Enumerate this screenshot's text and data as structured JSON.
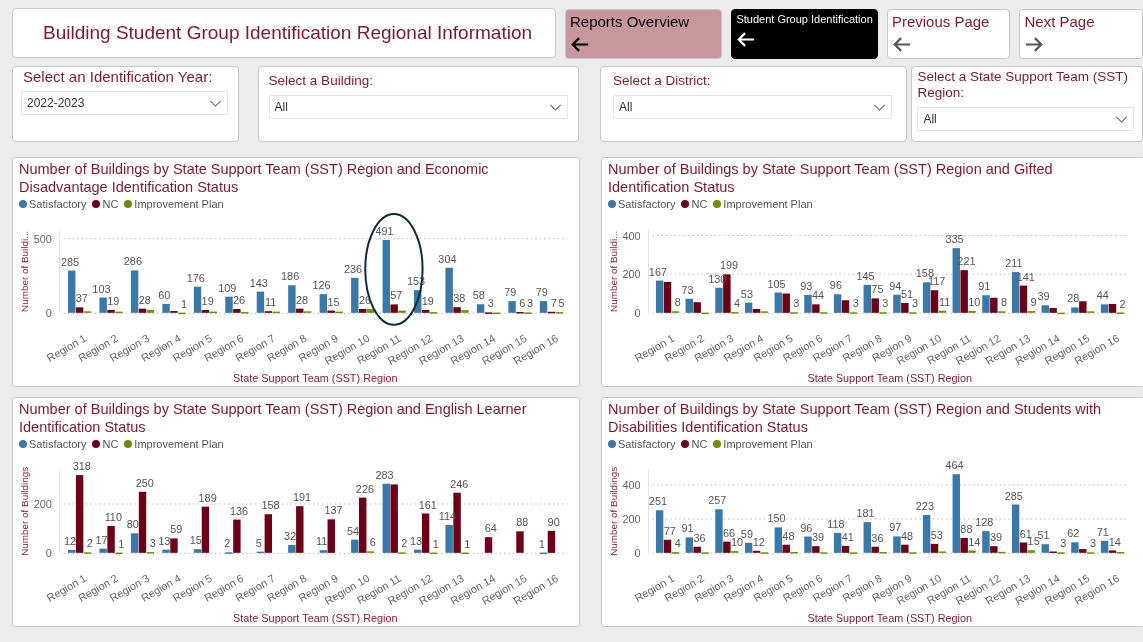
{
  "title": "Building Student Group Identification Regional Information",
  "nav_buttons": [
    {
      "label": "Reports Overview",
      "kind": "reports"
    },
    {
      "label": "Student Group Identification",
      "kind": "current"
    },
    {
      "label": "Previous Page",
      "kind": "back"
    },
    {
      "label": "Next Page",
      "kind": "next"
    }
  ],
  "filters": [
    {
      "label": "Select an Identification Year:",
      "value": "2022-2023"
    },
    {
      "label": "Select a Building:",
      "value": "All"
    },
    {
      "label": "Select a District:",
      "value": "All"
    },
    {
      "label": "Select a State Support Team (SST) Region:",
      "value": "All"
    }
  ],
  "charts": [
    {
      "chart_data": {
        "type": "bar",
        "title": "Number of Buildings by State Support Team (SST) Region and Economic Disadvantage Identification Status",
        "xlabel": "State Support Team (SST) Region",
        "ylabel": "Number of Buildi...",
        "categories": [
          "Region 1",
          "Region 2",
          "Region 3",
          "Region 4",
          "Region 5",
          "Region 6",
          "Region 7",
          "Region 8",
          "Region 9",
          "Region 10",
          "Region 11",
          "Region 12",
          "Region 13",
          "Region 14",
          "Region 15",
          "Region 16"
        ],
        "ylim": [
          0,
          560
        ],
        "yticks": [
          0,
          500
        ],
        "series": [
          {
            "name": "Satisfactory",
            "color": "#3a78a8",
            "values": [
              285,
              103,
              286,
              60,
              176,
              109,
              143,
              186,
              126,
              236,
              491,
              153,
              304,
              58,
              79,
              79
            ]
          },
          {
            "name": "NC",
            "color": "#6b0018",
            "values": [
              37,
              19,
              28,
              12,
              19,
              26,
              11,
              28,
              15,
              26,
              57,
              19,
              38,
              3,
              6,
              7
            ]
          },
          {
            "name": "Improvement Plan",
            "color": "#6a8f00",
            "values": [
              10,
              8,
              20,
              1,
              8,
              5,
              8,
              10,
              8,
              25,
              15,
              5,
              18,
              2,
              3,
              5
            ]
          }
        ],
        "value_labels": [
          [
            "285",
            "103",
            "286",
            "60",
            "176",
            "109",
            "143",
            "186",
            "126",
            "236",
            "491",
            "153",
            "304",
            "58",
            "79",
            "79"
          ],
          [
            "37",
            "19",
            "28",
            null,
            "19",
            "26",
            "11",
            "28",
            "15",
            "26",
            "57",
            "19",
            "38",
            "3",
            "6",
            "7"
          ],
          [
            null,
            null,
            null,
            "1",
            null,
            null,
            null,
            null,
            null,
            null,
            null,
            null,
            null,
            null,
            "3",
            "5"
          ]
        ],
        "annotations": [
          {
            "x": "Region 11"
          }
        ]
      }
    },
    {
      "chart_data": {
        "type": "bar",
        "title": "Number of Buildings by State Support Team (SST) Region and Gifted Identification Status",
        "xlabel": "State Support Team (SST) Region",
        "ylabel": "Number of Buildi...",
        "categories": [
          "Region 1",
          "Region 2",
          "Region 3",
          "Region 4",
          "Region 5",
          "Region 6",
          "Region 7",
          "Region 8",
          "Region 9",
          "Region 10",
          "Region 11",
          "Region 12",
          "Region 13",
          "Region 14",
          "Region 15",
          "Region 16"
        ],
        "ylim": [
          0,
          430
        ],
        "yticks": [
          0,
          200,
          400
        ],
        "series": [
          {
            "name": "Satisfactory",
            "color": "#3a78a8",
            "values": [
              167,
              73,
              130,
              53,
              105,
              93,
              96,
              145,
              94,
              158,
              335,
              91,
              211,
              39,
              28,
              44
            ]
          },
          {
            "name": "NC",
            "color": "#6b0018",
            "values": [
              160,
              55,
              199,
              20,
              100,
              44,
              65,
              75,
              51,
              117,
              221,
              78,
              141,
              25,
              60,
              46
            ]
          },
          {
            "name": "Improvement Plan",
            "color": "#6a8f00",
            "values": [
              8,
              1,
              4,
              0,
              3,
              3,
              3,
              3,
              3,
              11,
              10,
              8,
              9,
              1,
              0,
              2
            ]
          }
        ],
        "value_labels": [
          [
            "167",
            "73",
            "130",
            "53",
            "105",
            "93",
            "96",
            "145",
            "94",
            "158",
            "335",
            "91",
            "211",
            "39",
            "28",
            "44"
          ],
          [
            null,
            null,
            "199",
            null,
            null,
            "44",
            null,
            "75",
            "51",
            "117",
            "221",
            null,
            "141",
            null,
            null,
            null
          ],
          [
            "8",
            null,
            "4",
            null,
            "3",
            null,
            "3",
            "3",
            "3",
            "11",
            "10",
            "8",
            "9",
            null,
            null,
            "2"
          ]
        ]
      }
    },
    {
      "chart_data": {
        "type": "bar",
        "title": "Number of Buildings by State Support Team (SST) Region and English Learner Identification Status",
        "xlabel": "State Support Team (SST) Region",
        "ylabel": "Number of Buildings",
        "categories": [
          "Region 1",
          "Region 2",
          "Region 3",
          "Region 4",
          "Region 5",
          "Region 6",
          "Region 7",
          "Region 8",
          "Region 9",
          "Region 10",
          "Region 11",
          "Region 12",
          "Region 13",
          "Region 14",
          "Region 15",
          "Region 16"
        ],
        "ylim": [
          0,
          340
        ],
        "yticks": [
          0,
          200
        ],
        "series": [
          {
            "name": "Satisfactory",
            "color": "#3a78a8",
            "values": [
              12,
              17,
              80,
              13,
              15,
              2,
              5,
              32,
              11,
              54,
              283,
              13,
              114,
              null,
              null,
              1
            ]
          },
          {
            "name": "NC",
            "color": "#6b0018",
            "values": [
              318,
              110,
              250,
              59,
              189,
              136,
              158,
              191,
              137,
              226,
              280,
              161,
              246,
              64,
              88,
              90
            ]
          },
          {
            "name": "Improvement Plan",
            "color": "#6a8f00",
            "values": [
              2,
              1,
              3,
              null,
              null,
              null,
              null,
              null,
              null,
              6,
              2,
              1,
              1,
              null,
              null,
              null
            ]
          }
        ],
        "value_labels": [
          [
            "12",
            "17",
            "80",
            "13",
            "15",
            "2",
            "5",
            "32",
            "11",
            "54",
            "283",
            "13",
            "114",
            null,
            null,
            "1"
          ],
          [
            "318",
            "110",
            "250",
            "59",
            "189",
            "136",
            "158",
            "191",
            "137",
            "226",
            null,
            "161",
            "246",
            "64",
            "88",
            "90"
          ],
          [
            "2",
            "1",
            "3",
            null,
            null,
            null,
            null,
            null,
            null,
            "6",
            "2",
            "1",
            "1",
            null,
            null,
            null
          ]
        ]
      }
    },
    {
      "chart_data": {
        "type": "bar",
        "title": "Number of Buildings by State Support Team (SST) Region and Students with Disabilities Identification Status",
        "xlabel": "State Support Team (SST) Region",
        "ylabel": "Number of Buildings",
        "categories": [
          "Region 1",
          "Region 2",
          "Region 3",
          "Region 4",
          "Region 5",
          "Region 6",
          "Region 7",
          "Region 8",
          "Region 9",
          "Region 10",
          "Region 11",
          "Region 12",
          "Region 13",
          "Region 14",
          "Region 15",
          "Region 16"
        ],
        "ylim": [
          0,
          490
        ],
        "yticks": [
          0,
          200,
          400
        ],
        "series": [
          {
            "name": "Satisfactory",
            "color": "#3a78a8",
            "values": [
              251,
              91,
              257,
              59,
              150,
              96,
              118,
              181,
              97,
              223,
              464,
              128,
              285,
              51,
              62,
              71
            ]
          },
          {
            "name": "NC",
            "color": "#6b0018",
            "values": [
              77,
              36,
              66,
              12,
              48,
              39,
              41,
              36,
              48,
              53,
              88,
              39,
              61,
              8,
              22,
              14
            ]
          },
          {
            "name": "Improvement Plan",
            "color": "#6a8f00",
            "values": [
              4,
              3,
              10,
              3,
              5,
              3,
              3,
              5,
              3,
              8,
              14,
              6,
              15,
              3,
              3,
              5
            ]
          }
        ],
        "value_labels": [
          [
            "251",
            "91",
            "257",
            "59",
            "150",
            "96",
            "118",
            "181",
            "97",
            "223",
            "464",
            "128",
            "285",
            "51",
            "62",
            "71"
          ],
          [
            "77",
            "36",
            "66",
            "12",
            "48",
            "39",
            "41",
            "36",
            "48",
            "53",
            "88",
            "39",
            "61",
            null,
            null,
            "14"
          ],
          [
            "4",
            null,
            "10",
            null,
            null,
            null,
            null,
            null,
            null,
            null,
            "14",
            null,
            "15",
            "3",
            "3",
            null
          ]
        ]
      }
    }
  ]
}
